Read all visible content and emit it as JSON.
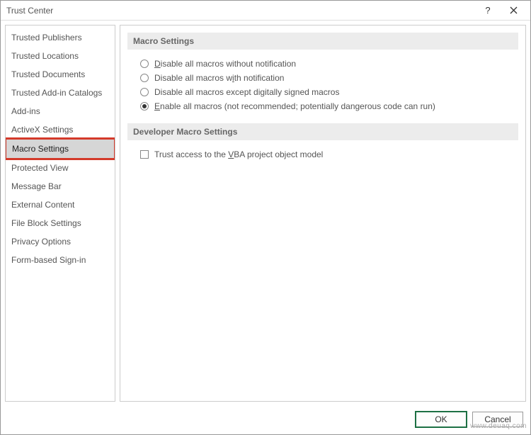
{
  "window": {
    "title": "Trust Center"
  },
  "sidebar": {
    "items": [
      {
        "label": "Trusted Publishers"
      },
      {
        "label": "Trusted Locations"
      },
      {
        "label": "Trusted Documents"
      },
      {
        "label": "Trusted Add-in Catalogs"
      },
      {
        "label": "Add-ins"
      },
      {
        "label": "ActiveX Settings"
      },
      {
        "label": "Macro Settings",
        "selected": true
      },
      {
        "label": "Protected View"
      },
      {
        "label": "Message Bar"
      },
      {
        "label": "External Content"
      },
      {
        "label": "File Block Settings"
      },
      {
        "label": "Privacy Options"
      },
      {
        "label": "Form-based Sign-in"
      }
    ]
  },
  "sections": {
    "macro": {
      "header": "Macro Settings",
      "options": [
        {
          "pre": "",
          "u": "D",
          "post": "isable all macros without notification",
          "checked": false
        },
        {
          "pre": "Disable all macros w",
          "u": "i",
          "post": "th notification",
          "checked": false
        },
        {
          "pre": "Disable all macros except di",
          "u": "g",
          "post": "itally signed macros",
          "checked": false
        },
        {
          "pre": "",
          "u": "E",
          "post": "nable all macros (not recommended; potentially dangerous code can run)",
          "checked": true
        }
      ]
    },
    "developer": {
      "header": "Developer Macro Settings",
      "checkbox": {
        "pre": "Trust access to the ",
        "u": "V",
        "post": "BA project object model",
        "checked": false
      }
    }
  },
  "buttons": {
    "ok": "OK",
    "cancel": "Cancel"
  },
  "watermark": "www.deuaq.com"
}
